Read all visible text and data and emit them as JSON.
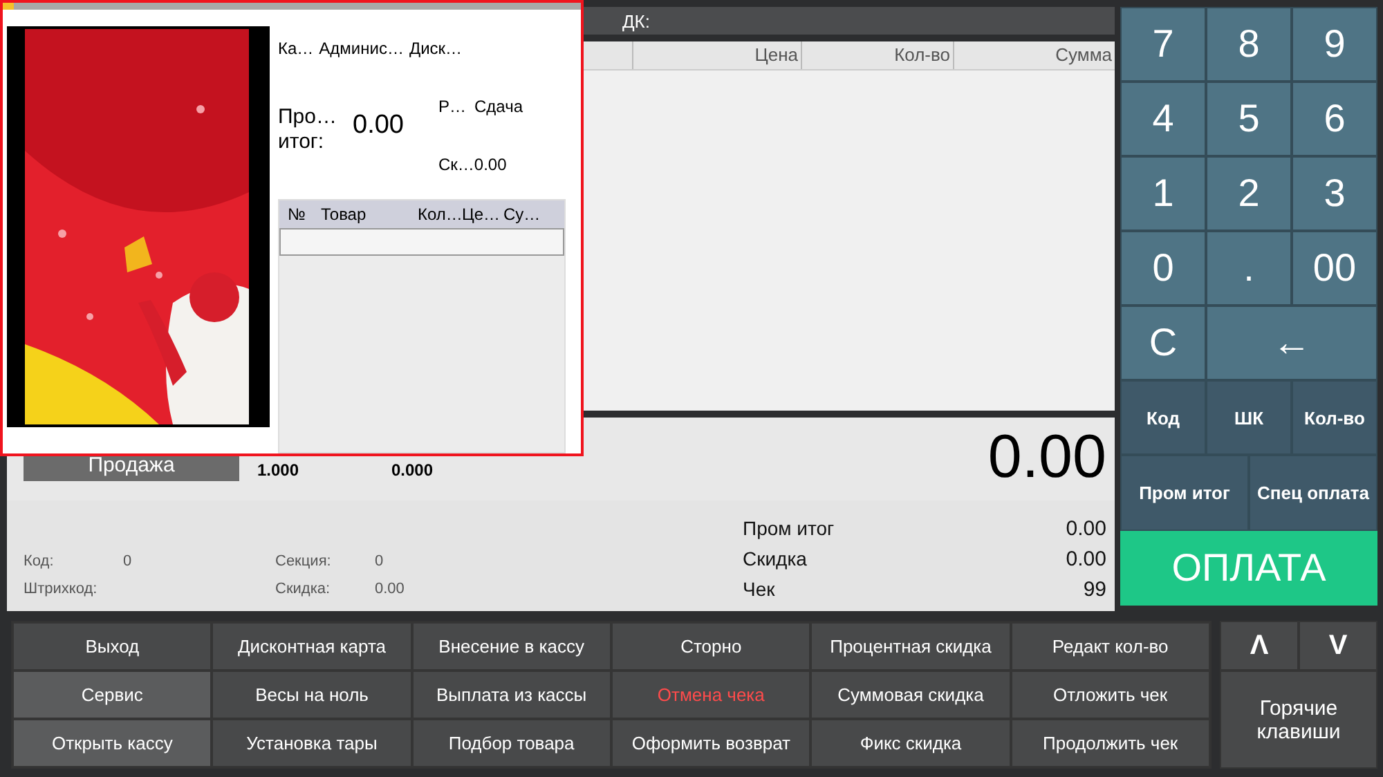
{
  "receipt": {
    "dk_label": "ДК:",
    "columns": [
      "Цена",
      "Кол-во",
      "Сумма"
    ]
  },
  "sale": {
    "mode_button": "Продажа",
    "quantity": "1.000",
    "price": "0.000",
    "total": "0.00",
    "fields": [
      {
        "label": "Код:",
        "value": "0"
      },
      {
        "label": "Секция:",
        "value": "0"
      },
      {
        "label": "Штрихкод:"
      },
      {
        "label": "Скидка:",
        "value": "0.00"
      }
    ],
    "summary": [
      {
        "label": "Пром итог",
        "value": "0.00"
      },
      {
        "label": "Скидка",
        "value": "0.00"
      },
      {
        "label": "Чек",
        "value": "99"
      }
    ]
  },
  "keypad": {
    "keys": [
      "7",
      "8",
      "9",
      "4",
      "5",
      "6",
      "1",
      "2",
      "3",
      "0",
      ".",
      "00",
      "C",
      "←"
    ],
    "function_keys": [
      "Код",
      "ШК",
      "Кол-во"
    ],
    "wide_keys": [
      "Пром итог",
      "Спец оплата"
    ],
    "pay_button": "ОПЛАТА"
  },
  "actions": [
    {
      "label": "Выход",
      "kind": "normal"
    },
    {
      "label": "Дисконтная карта",
      "kind": "normal"
    },
    {
      "label": "Внесение в кассу",
      "kind": "normal"
    },
    {
      "label": "Сторно",
      "kind": "normal"
    },
    {
      "label": "Процентная скидка",
      "kind": "normal"
    },
    {
      "label": "Редакт кол-во",
      "kind": "normal"
    },
    {
      "label": "Сервис",
      "kind": "light"
    },
    {
      "label": "Весы на ноль",
      "kind": "normal"
    },
    {
      "label": "Выплата из кассы",
      "kind": "normal"
    },
    {
      "label": "Отмена чека",
      "kind": "danger"
    },
    {
      "label": "Суммовая скидка",
      "kind": "normal"
    },
    {
      "label": "Отложить чек",
      "kind": "normal"
    },
    {
      "label": "Открыть кассу",
      "kind": "light"
    },
    {
      "label": "Установка тары",
      "kind": "normal"
    },
    {
      "label": "Подбор товара",
      "kind": "normal"
    },
    {
      "label": "Оформить возврат",
      "kind": "normal"
    },
    {
      "label": "Фикс скидка",
      "kind": "normal"
    },
    {
      "label": "Продолжить чек",
      "kind": "normal"
    }
  ],
  "hotkeys": {
    "up": "Λ",
    "down": "V",
    "label": "Горячие клавиши"
  },
  "customer_display": {
    "header": [
      "Ка…",
      "Админис…",
      "Диск…"
    ],
    "subtotal_label": "Про… итог:",
    "subtotal": "0.00",
    "change_labels": [
      "Р…",
      "Сдача"
    ],
    "discount_label": "Ск…",
    "discount": "0.00",
    "columns": [
      "№",
      "Товар",
      "Кол…",
      "Це…",
      "Су…"
    ],
    "picture": {
      "kind": "picture"
    }
  }
}
